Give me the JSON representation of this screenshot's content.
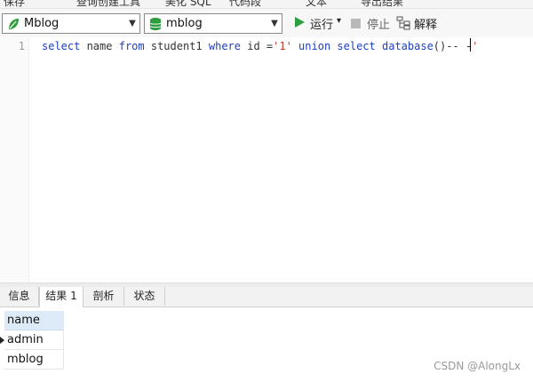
{
  "top_menu": [
    "保存",
    "查询创建工具",
    "美化 SQL",
    "代码段",
    "文本",
    "导出结果"
  ],
  "toolbar": {
    "connection": "Mblog",
    "database": "mblog",
    "run_label": "运行",
    "run_dropdown": "▾",
    "stop_label": "停止",
    "explain_label": "解释"
  },
  "editor": {
    "line_number": "1",
    "tokens": {
      "t1": "select",
      "t2": " name ",
      "t3": "from",
      "t4": " student1 ",
      "t5": "where",
      "t6": " id =",
      "t7": "'1'",
      "t8": " ",
      "t9": "union",
      "t10": " ",
      "t11": "select",
      "t12": " ",
      "t13": "database",
      "t14": "()-- -",
      "t15": "'"
    }
  },
  "result_tabs": [
    "信息",
    "结果 1",
    "剖析",
    "状态"
  ],
  "active_tab_index": 1,
  "result_grid": {
    "column": "name",
    "rows": [
      "admin",
      "mblog"
    ]
  },
  "watermark": "CSDN @AlongLx",
  "colors": {
    "keyword": "#1d3fbf",
    "string": "#c0392b",
    "run_icon": "#2e9e3e",
    "header_bg": "#dcebf7"
  }
}
